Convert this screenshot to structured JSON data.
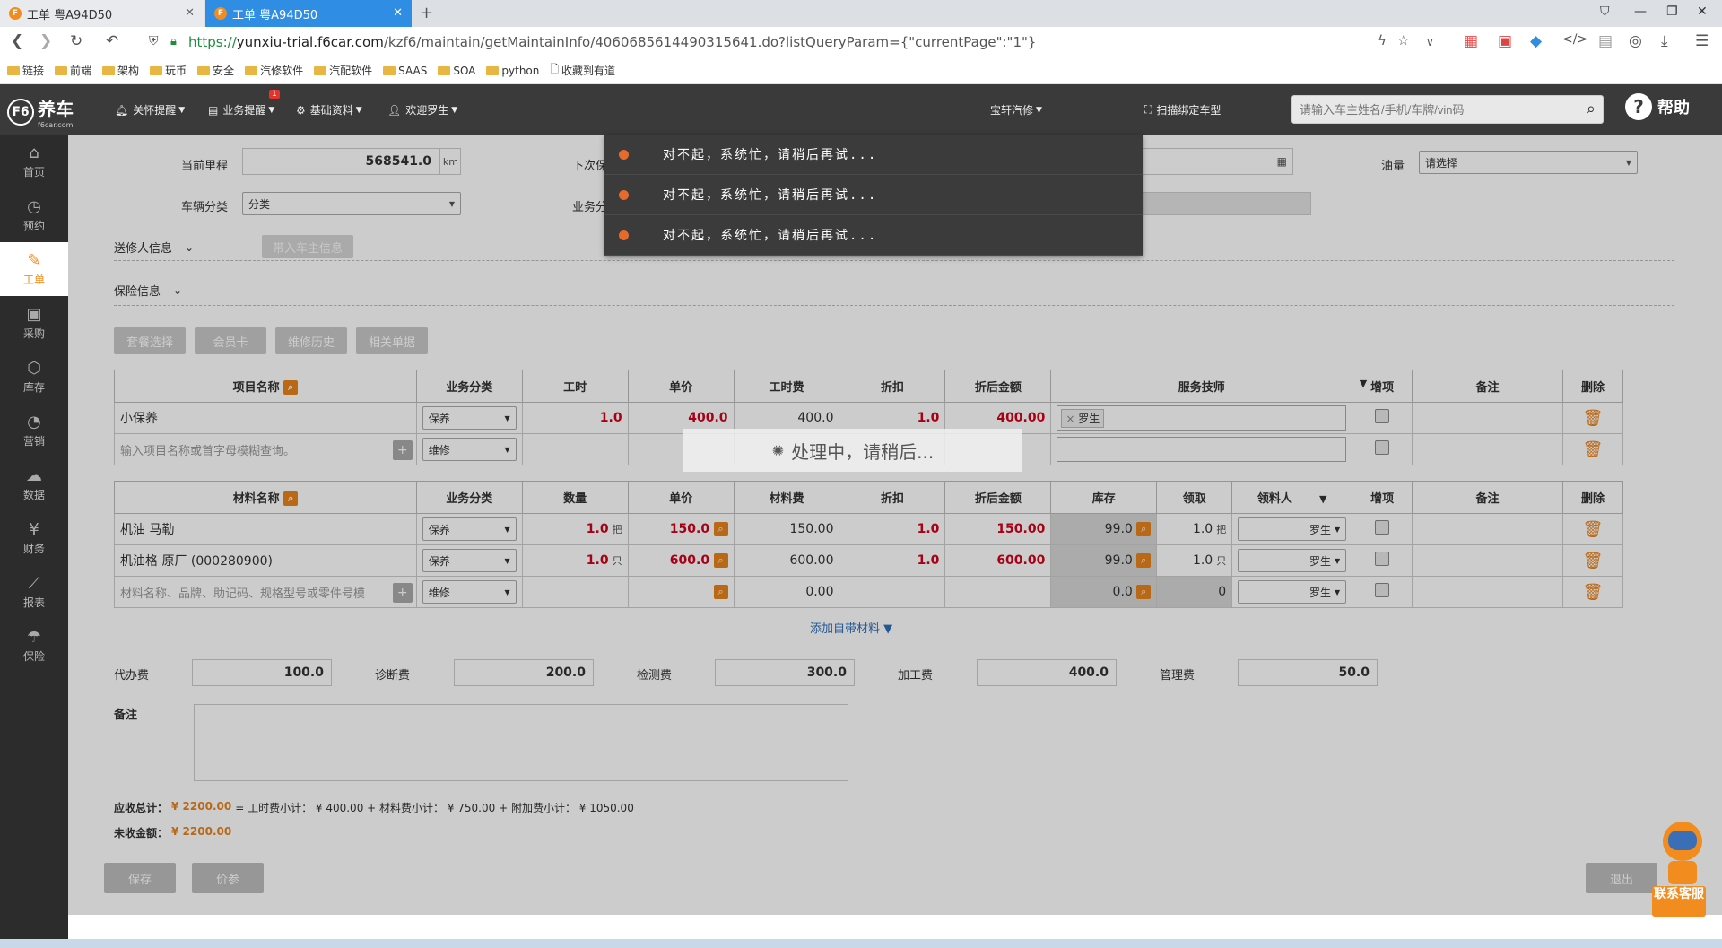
{
  "browser": {
    "tabs": [
      {
        "title": "工单 粤A94D50",
        "active": false
      },
      {
        "title": "工单 粤A94D50",
        "active": true
      }
    ],
    "url_protocol": "https://",
    "url_domain": "yunxiu-trial.f6car.com",
    "url_path": "/kzf6/maintain/getMaintainInfo/4060685614490315641.do?listQueryParam={\"currentPage\":\"1\"}",
    "bookmarks": [
      "链接",
      "前端",
      "架构",
      "玩币",
      "安全",
      "汽修软件",
      "汽配软件",
      "SAAS",
      "SOA",
      "python",
      "收藏到有道"
    ]
  },
  "header": {
    "logo_text": "养车",
    "logo_sub": "f6car.com",
    "menus": [
      {
        "icon": "bell-icon",
        "label": "关怀提醒"
      },
      {
        "icon": "business-icon",
        "label": "业务提醒",
        "badge": "1"
      },
      {
        "icon": "gear-icon",
        "label": "基础资料"
      },
      {
        "icon": "user-icon",
        "label": "欢迎罗生"
      }
    ],
    "shop": "宝轩汽修",
    "scan_label": "扫描绑定车型",
    "search_placeholder": "请输入车主姓名/手机/车牌/vin码",
    "help_label": "帮助"
  },
  "sidebar": [
    {
      "label": "首页",
      "icon": "home-icon",
      "glyph": "⌂"
    },
    {
      "label": "预约",
      "icon": "clock-icon",
      "glyph": "◷"
    },
    {
      "label": "工单",
      "icon": "wrench-icon",
      "glyph": "✎",
      "active": true
    },
    {
      "label": "采购",
      "icon": "cart-icon",
      "glyph": "▣"
    },
    {
      "label": "库存",
      "icon": "box-icon",
      "glyph": "⬡"
    },
    {
      "label": "营销",
      "icon": "pie-icon",
      "glyph": "◔"
    },
    {
      "label": "数据",
      "icon": "cloud-icon",
      "glyph": "☁"
    },
    {
      "label": "财务",
      "icon": "yen-icon",
      "glyph": "¥"
    },
    {
      "label": "报表",
      "icon": "chart-icon",
      "glyph": "⟋"
    },
    {
      "label": "保险",
      "icon": "umbrella-icon",
      "glyph": "☂"
    }
  ],
  "form": {
    "mileage_label": "当前里程",
    "mileage_value": "568541.0",
    "mileage_unit": "km",
    "next_label": "下次保",
    "oil_label": "油量",
    "oil_value": "请选择",
    "vehicle_cat_label": "车辆分类",
    "vehicle_cat_value": "分类一",
    "biz_cat_label": "业务分",
    "sender_section": "送修人信息",
    "bring_owner_button": "带入车主信息",
    "insurance_section": "保险信息",
    "action_buttons": [
      "套餐选择",
      "会员卡",
      "维修历史",
      "相关单据"
    ]
  },
  "items_table": {
    "headers": [
      "项目名称",
      "业务分类",
      "工时",
      "单价",
      "工时费",
      "折扣",
      "折后金额",
      "服务技师",
      "增项",
      "备注",
      "删除"
    ],
    "rows": [
      {
        "name": "小保养",
        "category": "保养",
        "hours": "1.0",
        "price": "400.0",
        "fee": "400.0",
        "discount": "1.0",
        "amount": "400.00",
        "tech": "罗生"
      }
    ],
    "new_row": {
      "placeholder": "输入项目名称或首字母模糊查询。",
      "category": "维修"
    }
  },
  "materials_table": {
    "headers": [
      "材料名称",
      "业务分类",
      "数量",
      "单价",
      "材料费",
      "折扣",
      "折后金额",
      "库存",
      "领取",
      "领料人",
      "增项",
      "备注",
      "删除"
    ],
    "rows": [
      {
        "name": "机油 马勒",
        "category": "保养",
        "qty": "1.0",
        "unit": "把",
        "price": "150.0",
        "fee": "150.00",
        "discount": "1.0",
        "amount": "150.00",
        "stock": "99.0",
        "taken": "1.0",
        "taken_unit": "把",
        "picker": "罗生"
      },
      {
        "name": "机油格 原厂 (000280900)",
        "category": "保养",
        "qty": "1.0",
        "unit": "只",
        "price": "600.0",
        "fee": "600.00",
        "discount": "1.0",
        "amount": "600.00",
        "stock": "99.0",
        "taken": "1.0",
        "taken_unit": "只",
        "picker": "罗生"
      }
    ],
    "new_row": {
      "placeholder": "材料名称、品牌、助记码、规格型号或零件号模",
      "category": "维修",
      "fee": "0.00",
      "stock": "0.0",
      "taken": "0",
      "picker": "罗生"
    },
    "add_own_label": "添加自带材料 ▼"
  },
  "fees": [
    {
      "label": "代办费",
      "value": "100.0"
    },
    {
      "label": "诊断费",
      "value": "200.0"
    },
    {
      "label": "检测费",
      "value": "300.0"
    },
    {
      "label": "加工费",
      "value": "400.0"
    },
    {
      "label": "管理费",
      "value": "50.0"
    }
  ],
  "remark_label": "备注",
  "totals": {
    "receivable_label": "应收总计：",
    "receivable_value": "¥ 2200.00",
    "formula": "= 工时费小计： ¥ 400.00 + 材料费小计： ¥ 750.00 + 附加费小计： ¥ 1050.00",
    "unpaid_label": "未收金额：",
    "unpaid_value": "¥ 2200.00"
  },
  "footer_buttons": {
    "save": "保存",
    "price": "价参",
    "exit": "退出"
  },
  "toasts": [
    "对不起，系统忙，请稍后再试...",
    "对不起，系统忙，请稍后再试...",
    "对不起，系统忙，请稍后再试..."
  ],
  "loading_text": "处理中，请稍后...",
  "contact": "联系客服",
  "colors": {
    "accent": "#f28c1e",
    "danger": "#d0021b",
    "header": "#3a3a3a",
    "sidebar": "#2c2c2c",
    "tab_active": "#2f8de4"
  }
}
